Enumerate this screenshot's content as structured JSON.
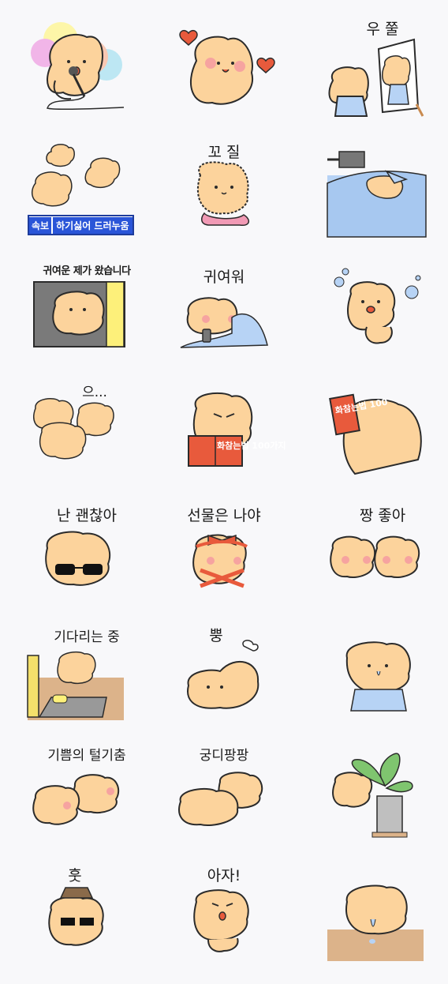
{
  "stickers": [
    {
      "caption": ""
    },
    {
      "caption": ""
    },
    {
      "caption": "우 쭐"
    },
    {
      "caption": "",
      "news_tag": "속보",
      "news_text": "하기싫어 드러누움"
    },
    {
      "caption": "꼬 질"
    },
    {
      "caption": ""
    },
    {
      "caption": "귀여운 제가 왔습니다"
    },
    {
      "caption": "귀여워"
    },
    {
      "caption": ""
    },
    {
      "caption": "으..."
    },
    {
      "caption": "",
      "book_text": "화참는법 100가지"
    },
    {
      "caption": "",
      "book_text": "화참는법 100"
    },
    {
      "caption": "난 괜찮아"
    },
    {
      "caption": "선물은 나야"
    },
    {
      "caption": "짱 좋아"
    },
    {
      "caption": "기다리는 중"
    },
    {
      "caption": "뿡"
    },
    {
      "caption": ""
    },
    {
      "caption": "기쁨의 털기춤"
    },
    {
      "caption": "궁디팡팡"
    },
    {
      "caption": ""
    },
    {
      "caption": "훗"
    },
    {
      "caption": "아자!"
    },
    {
      "caption": ""
    }
  ],
  "colors": {
    "fur": "#fcd39c",
    "outline": "#2b2b2b",
    "blush": "#f6a3a0",
    "blue": "#b7d3f5",
    "red": "#e85a3c",
    "background": "#f8f8fa"
  }
}
